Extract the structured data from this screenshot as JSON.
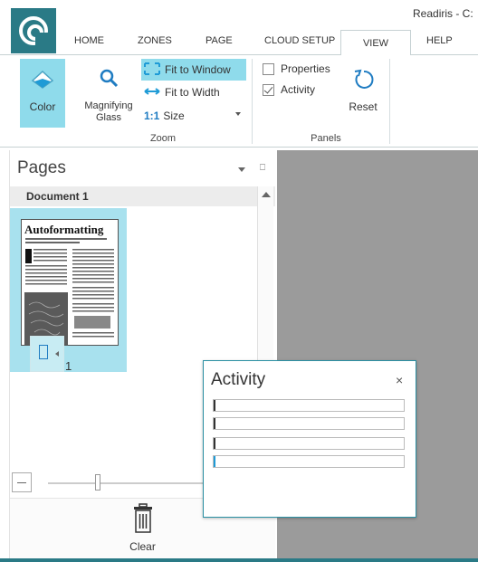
{
  "window": {
    "title": "Readiris - C:"
  },
  "menu": {
    "tabs": [
      {
        "label": "HOME"
      },
      {
        "label": "ZONES"
      },
      {
        "label": "PAGE"
      },
      {
        "label": "CLOUD SETUP"
      },
      {
        "label": "VIEW",
        "active": true
      },
      {
        "label": "HELP"
      }
    ]
  },
  "ribbon": {
    "color_label": "Color",
    "magnify_label": "Magnifying Glass",
    "fit_window_label": "Fit to Window",
    "fit_width_label": "Fit to Width",
    "size_ratio": "1:1",
    "size_label": "Size",
    "zoom_group_label": "Zoom",
    "properties_label": "Properties",
    "activity_label": "Activity",
    "reset_label": "Reset",
    "panels_group_label": "Panels",
    "properties_checked": false,
    "activity_checked": true
  },
  "pages_panel": {
    "title": "Pages",
    "document_name": "Document 1",
    "thumbnail_title": "Autoformatting",
    "page_number": "1",
    "clear_label": "Clear"
  },
  "activity_dialog": {
    "title": "Activity",
    "close_glyph": "×",
    "progress_rows": 4
  },
  "colors": {
    "brand": "#2a7a86",
    "highlight": "#8fdbeb",
    "document_area": "#9b9b9b"
  },
  "icons": {
    "logo": "readiris-logo-icon",
    "color": "color-icon",
    "magnify": "magnifier-icon",
    "fit_window": "fit-window-icon",
    "fit_width": "fit-width-icon",
    "reset": "reset-icon",
    "trash": "trash-icon"
  }
}
